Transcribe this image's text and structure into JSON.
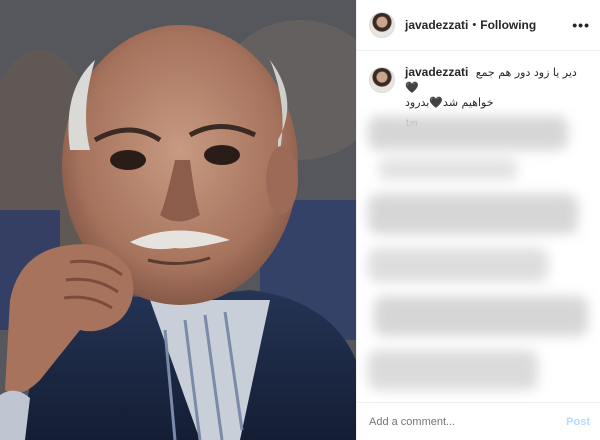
{
  "post": {
    "username": "javadezzati",
    "follow_separator": "•",
    "follow_label": "Following",
    "more_label": "•••",
    "caption_line1": "دیر یا زود دور هم جمع🖤",
    "caption_line2": "خواهیم شد🖤بدرود",
    "time": "1m",
    "photo_subject": "portrait-photo",
    "comment_placeholder": "Add a comment...",
    "post_label": "Post"
  },
  "colors": {
    "post_button": "#b3dbff",
    "text": "#262626",
    "muted": "#999999",
    "border": "#efefef"
  },
  "icons": {
    "avatar": "profile-avatar",
    "more": "more-options-icon"
  }
}
